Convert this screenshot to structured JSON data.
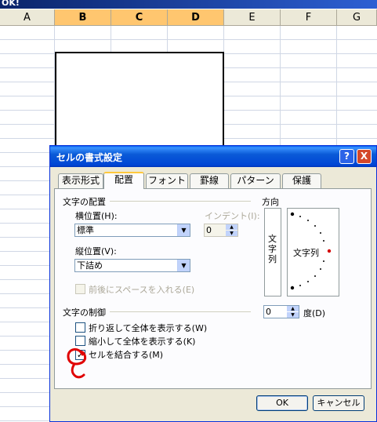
{
  "window": {
    "title_fragment": "OK!"
  },
  "sheet": {
    "columns": [
      {
        "label": "A",
        "selected": false
      },
      {
        "label": "B",
        "selected": true
      },
      {
        "label": "C",
        "selected": true
      },
      {
        "label": "D",
        "selected": true
      },
      {
        "label": "E",
        "selected": false
      },
      {
        "label": "F",
        "selected": false
      },
      {
        "label": "G",
        "selected": false
      }
    ]
  },
  "dialog": {
    "title": "セルの書式設定",
    "help_button": "?",
    "close_button": "X",
    "tabs": [
      {
        "label": "表示形式",
        "active": false
      },
      {
        "label": "配置",
        "active": true
      },
      {
        "label": "フォント",
        "active": false
      },
      {
        "label": "罫線",
        "active": false
      },
      {
        "label": "パターン",
        "active": false
      },
      {
        "label": "保護",
        "active": false
      }
    ],
    "alignment": {
      "section_title": "文字の配置",
      "horizontal_label": "横位置(H):",
      "horizontal_value": "標準",
      "indent_label": "インデント(I):",
      "indent_value": "0",
      "vertical_label": "縦位置(V):",
      "vertical_value": "下詰め",
      "space_label": "前後にスペースを入れる(E)"
    },
    "orientation": {
      "section_title": "方向",
      "vertical_text": "文字列",
      "dial_text": "文字列",
      "degree_value": "0",
      "degree_label": "度(D)"
    },
    "text_control": {
      "section_title": "文字の制御",
      "wrap_label": "折り返して全体を表示する(W)",
      "wrap_checked": false,
      "shrink_label": "縮小して全体を表示する(K)",
      "shrink_checked": false,
      "merge_label": "セルを結合する(M)",
      "merge_checked": true
    },
    "ok_button": "OK",
    "cancel_button": "キャンセル"
  }
}
